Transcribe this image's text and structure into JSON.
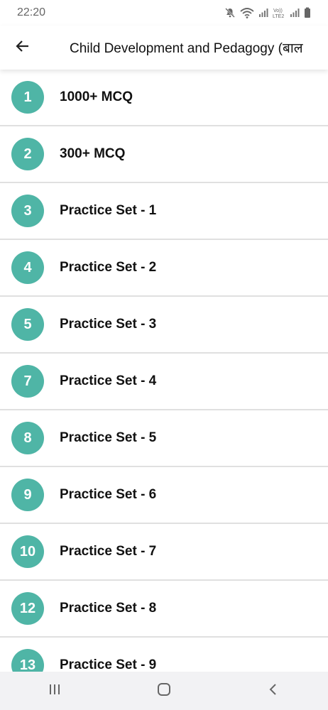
{
  "status_bar": {
    "time": "22:20",
    "icons": [
      "mute-icon",
      "wifi-icon",
      "signal-icon",
      "volte-lte2-icon",
      "signal-icon-2",
      "battery-icon"
    ]
  },
  "app_bar": {
    "back_icon": "arrow-left-icon",
    "title": "Child Development and Pedagogy (बाल"
  },
  "colors": {
    "accent": "#4fb5a6",
    "divider": "#e0e0e0",
    "nav_bg": "#f2f2f4"
  },
  "list": {
    "items": [
      {
        "number": "1",
        "label": "1000+ MCQ"
      },
      {
        "number": "2",
        "label": "300+ MCQ"
      },
      {
        "number": "3",
        "label": "Practice Set - 1"
      },
      {
        "number": "4",
        "label": "Practice Set - 2"
      },
      {
        "number": "5",
        "label": "Practice Set - 3"
      },
      {
        "number": "7",
        "label": "Practice Set - 4"
      },
      {
        "number": "8",
        "label": "Practice Set - 5"
      },
      {
        "number": "9",
        "label": "Practice Set - 6"
      },
      {
        "number": "10",
        "label": "Practice Set - 7"
      },
      {
        "number": "12",
        "label": "Practice Set - 8"
      },
      {
        "number": "13",
        "label": "Practice Set - 9"
      }
    ]
  },
  "nav_bar": {
    "buttons": [
      "recent-apps-icon",
      "home-icon",
      "back-icon"
    ]
  }
}
